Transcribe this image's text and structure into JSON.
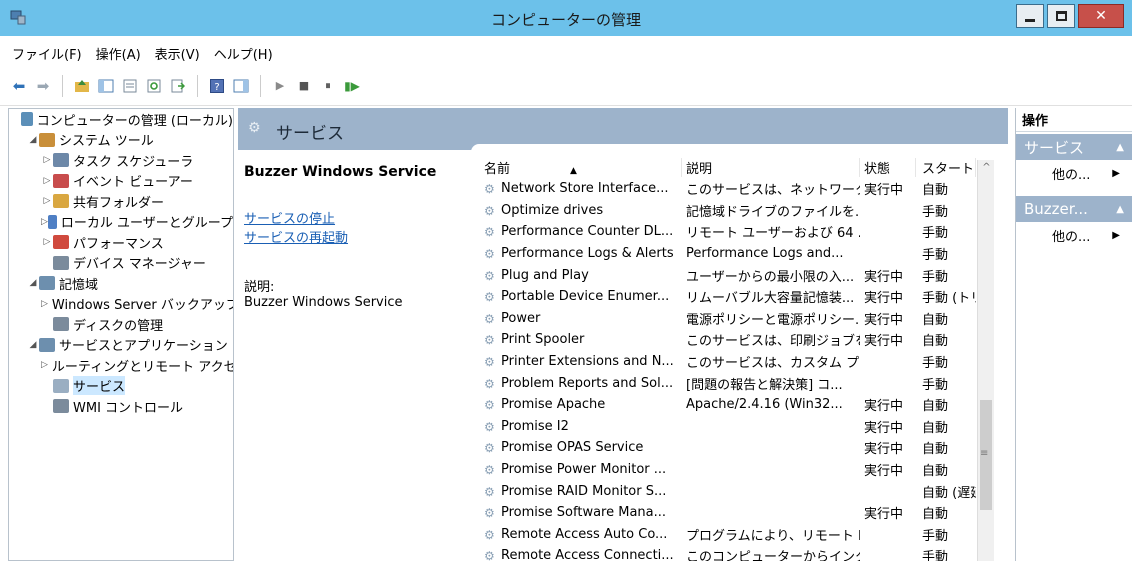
{
  "window": {
    "title": "コンピューターの管理"
  },
  "menu": [
    "ファイル(F)",
    "操作(A)",
    "表示(V)",
    "ヘルプ(H)"
  ],
  "tree": [
    {
      "label": "コンピューターの管理 (ローカル)",
      "level": 0,
      "arrow": "",
      "color": "#5b8fb8"
    },
    {
      "label": "システム ツール",
      "level": 1,
      "arrow": "◢",
      "color": "#c98f3a"
    },
    {
      "label": "タスク スケジューラ",
      "level": 2,
      "arrow": "▷",
      "color": "#6d88a8"
    },
    {
      "label": "イベント ビューアー",
      "level": 2,
      "arrow": "▷",
      "color": "#c84c4c"
    },
    {
      "label": "共有フォルダー",
      "level": 2,
      "arrow": "▷",
      "color": "#d9a741"
    },
    {
      "label": "ローカル ユーザーとグループ",
      "level": 2,
      "arrow": "▷",
      "color": "#4f7fc4"
    },
    {
      "label": "パフォーマンス",
      "level": 2,
      "arrow": "▷",
      "color": "#d04a3e"
    },
    {
      "label": "デバイス マネージャー",
      "level": 2,
      "arrow": "",
      "color": "#7b8b9c"
    },
    {
      "label": "記憶域",
      "level": 1,
      "arrow": "◢",
      "color": "#6d8fae"
    },
    {
      "label": "Windows Server バックアップ",
      "level": 2,
      "arrow": "▷",
      "color": "#5ea65e"
    },
    {
      "label": "ディスクの管理",
      "level": 2,
      "arrow": "",
      "color": "#7b8b9c"
    },
    {
      "label": "サービスとアプリケーション",
      "level": 1,
      "arrow": "◢",
      "color": "#6d8fae"
    },
    {
      "label": "ルーティングとリモート アクセス",
      "level": 2,
      "arrow": "▷",
      "color": "#c9603e"
    },
    {
      "label": "サービス",
      "level": 2,
      "arrow": "",
      "color": "#9aaec2",
      "selected": true
    },
    {
      "label": "WMI コントロール",
      "level": 2,
      "arrow": "",
      "color": "#7b8b9c"
    }
  ],
  "center": {
    "header_title": "サービス",
    "selected_service": "Buzzer Windows Service",
    "links": [
      "サービスの停止",
      "サービスの再起動"
    ],
    "desc_label": "説明:",
    "desc_value": "Buzzer Windows Service"
  },
  "table": {
    "columns": [
      "名前",
      "説明",
      "状態",
      "スタートアップ"
    ],
    "rows": [
      [
        "Network Store Interface...",
        "このサービスは、ネットワーク...",
        "実行中",
        "自動"
      ],
      [
        "Optimize drives",
        "記憶域ドライブのファイルを...",
        "",
        "手動"
      ],
      [
        "Performance Counter DL...",
        "リモート ユーザーおよび 64 ...",
        "",
        "手動"
      ],
      [
        "Performance Logs & Alerts",
        "Performance Logs and...",
        "",
        "手動"
      ],
      [
        "Plug and Play",
        "ユーザーからの最小限の入...",
        "実行中",
        "手動"
      ],
      [
        "Portable Device Enumer...",
        "リムーバブル大容量記憶装...",
        "実行中",
        "手動 (トリ"
      ],
      [
        "Power",
        "電源ポリシーと電源ポリシー...",
        "実行中",
        "自動"
      ],
      [
        "Print Spooler",
        "このサービスは、印刷ジョブを...",
        "実行中",
        "自動"
      ],
      [
        "Printer Extensions and N...",
        "このサービスは、カスタム プリ...",
        "",
        "手動"
      ],
      [
        "Problem Reports and Sol...",
        "[問題の報告と解決策] コ...",
        "",
        "手動"
      ],
      [
        "Promise Apache",
        "Apache/2.4.16 (Win32...",
        "実行中",
        "自動"
      ],
      [
        "Promise I2",
        "",
        "実行中",
        "自動"
      ],
      [
        "Promise OPAS Service",
        "",
        "実行中",
        "自動"
      ],
      [
        "Promise Power Monitor ...",
        "",
        "実行中",
        "自動"
      ],
      [
        "Promise RAID Monitor S...",
        "",
        "",
        "自動 (遅延"
      ],
      [
        "Promise Software Mana...",
        "",
        "実行中",
        "自動"
      ],
      [
        "Remote Access Auto Co...",
        "プログラムにより、リモート D...",
        "",
        "手動"
      ],
      [
        "Remote Access Connecti...",
        "このコンピューターからインタ...",
        "",
        "手動"
      ]
    ]
  },
  "actions": {
    "title": "操作",
    "sections": [
      {
        "label": "サービス",
        "item": "他の..."
      },
      {
        "label": "Buzzer...",
        "item": "他の..."
      }
    ]
  }
}
